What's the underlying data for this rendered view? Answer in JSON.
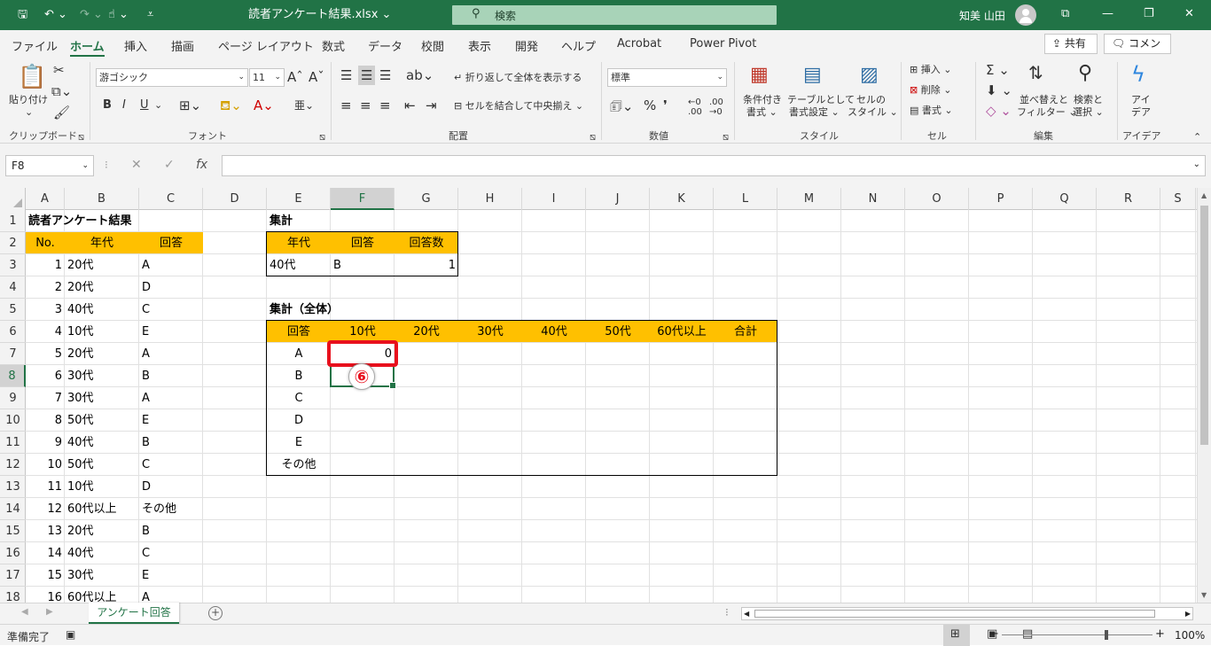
{
  "titlebar": {
    "doc_title": "読者アンケート結果.xlsx",
    "search_placeholder": "検索",
    "user_name": "知美 山田"
  },
  "menu": {
    "tabs": [
      "ファイル",
      "ホーム",
      "挿入",
      "描画",
      "ページ レイアウト",
      "数式",
      "データ",
      "校閲",
      "表示",
      "開発",
      "ヘルプ",
      "Acrobat",
      "Power Pivot"
    ],
    "active_tab": "ホーム",
    "share_label": "共有",
    "comment_label": "コメント"
  },
  "ribbon": {
    "clipboard": {
      "paste_label": "貼り付け",
      "group_label": "クリップボード"
    },
    "font": {
      "font_name": "游ゴシック",
      "font_size": "11",
      "group_label": "フォント",
      "bold": "B",
      "italic": "I",
      "underline": "U"
    },
    "alignment": {
      "wrap_text": "折り返して全体を表示する",
      "merge_center": "セルを結合して中央揃え",
      "group_label": "配置"
    },
    "number": {
      "format": "標準",
      "group_label": "数値"
    },
    "styles": {
      "conditional": "条件付き\n書式",
      "conditional_l1": "条件付き",
      "conditional_l2": "書式",
      "table_l1": "テーブルとして",
      "table_l2": "書式設定",
      "cell_l1": "セルの",
      "cell_l2": "スタイル",
      "group_label": "スタイル"
    },
    "cells": {
      "insert": "挿入",
      "delete": "削除",
      "format": "書式",
      "group_label": "セル"
    },
    "editing": {
      "sort_l1": "並べ替えと",
      "sort_l2": "フィルター",
      "find_l1": "検索と",
      "find_l2": "選択",
      "group_label": "編集"
    },
    "ideas": {
      "l1": "アイ",
      "l2": "デア",
      "group_label": "アイデア"
    }
  },
  "formula_bar": {
    "name_box": "F8",
    "formula": ""
  },
  "grid": {
    "columns": [
      "A",
      "B",
      "C",
      "D",
      "E",
      "F",
      "G",
      "H",
      "I",
      "J",
      "K",
      "L",
      "M",
      "N",
      "O",
      "P",
      "Q",
      "R",
      "S"
    ],
    "rows": [
      "1",
      "2",
      "3",
      "4",
      "5",
      "6",
      "7",
      "8",
      "9",
      "10",
      "11",
      "12",
      "13",
      "14",
      "15",
      "16",
      "17",
      "18"
    ],
    "selected_column": "F",
    "selected_row": "8",
    "left_table": {
      "title": "読者アンケート結果",
      "headers": [
        "No.",
        "年代",
        "回答"
      ],
      "rows": [
        [
          "1",
          "20代",
          "A"
        ],
        [
          "2",
          "20代",
          "D"
        ],
        [
          "3",
          "40代",
          "C"
        ],
        [
          "4",
          "10代",
          "E"
        ],
        [
          "5",
          "20代",
          "A"
        ],
        [
          "6",
          "30代",
          "B"
        ],
        [
          "7",
          "30代",
          "A"
        ],
        [
          "8",
          "50代",
          "E"
        ],
        [
          "9",
          "40代",
          "B"
        ],
        [
          "10",
          "50代",
          "C"
        ],
        [
          "11",
          "10代",
          "D"
        ],
        [
          "12",
          "60代以上",
          "その他"
        ],
        [
          "13",
          "20代",
          "B"
        ],
        [
          "14",
          "40代",
          "C"
        ],
        [
          "15",
          "30代",
          "E"
        ],
        [
          "16",
          "60代以上",
          "A"
        ]
      ]
    },
    "summary_table": {
      "title": "集計",
      "headers": [
        "年代",
        "回答",
        "回答数"
      ],
      "row": [
        "40代",
        "B",
        "1"
      ]
    },
    "overall_table": {
      "title": "集計（全体）",
      "headers": [
        "回答",
        "10代",
        "20代",
        "30代",
        "40代",
        "50代",
        "60代以上",
        "合計"
      ],
      "row_labels": [
        "A",
        "B",
        "C",
        "D",
        "E",
        "その他"
      ],
      "a_10s_value": "0"
    },
    "step_badge": "⑥"
  },
  "sheet_tabs": {
    "active": "アンケート回答"
  },
  "status": {
    "ready": "準備完了",
    "zoom": "100%"
  }
}
